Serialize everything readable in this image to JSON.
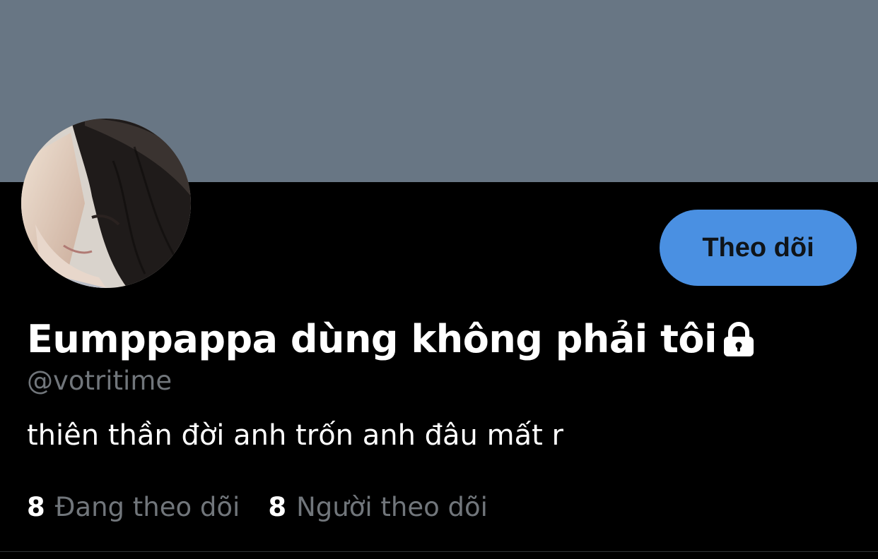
{
  "profile": {
    "display_name": "Eumppappa dùng không phải tôi",
    "handle": "@votritime",
    "bio": "thiên thần đời anh trốn anh đâu mất r",
    "protected_icon": "lock-icon",
    "avatar_icon": "avatar-photo"
  },
  "actions": {
    "follow_label": "Theo dõi"
  },
  "stats": {
    "following_count": "8",
    "following_label": "Đang theo dõi",
    "followers_count": "8",
    "followers_label": "Người theo dõi"
  },
  "colors": {
    "banner": "#687684",
    "background": "#000000",
    "follow_button": "#4a90e2",
    "secondary_text": "#71767b",
    "primary_text": "#ffffff"
  }
}
